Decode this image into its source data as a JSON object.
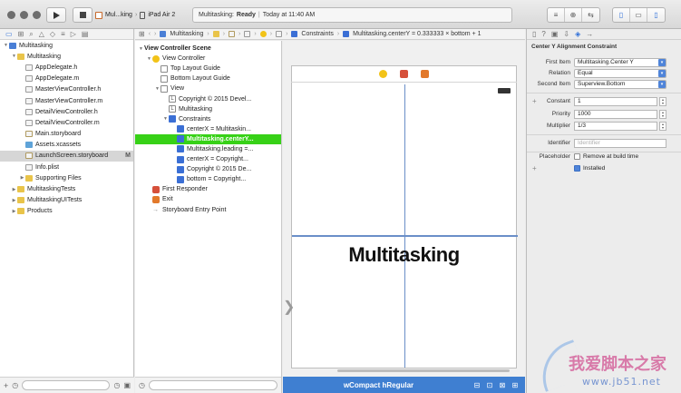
{
  "toolbar": {
    "scheme_name": "Mul...king",
    "device_name": "iPad Air 2",
    "status_app": "Multitasking:",
    "status_state": "Ready",
    "status_sep": "|",
    "status_time": "Today at 11:40 AM"
  },
  "navigator": {
    "items": [
      {
        "label": "Multitasking",
        "type": "proj",
        "indent": 0,
        "disclosure": "▼"
      },
      {
        "label": "Multitasking",
        "type": "folder",
        "indent": 1,
        "disclosure": "▼"
      },
      {
        "label": "AppDelegate.h",
        "type": "hfile",
        "indent": 2,
        "disclosure": ""
      },
      {
        "label": "AppDelegate.m",
        "type": "mfile",
        "indent": 2,
        "disclosure": ""
      },
      {
        "label": "MasterViewController.h",
        "type": "hfile",
        "indent": 2,
        "disclosure": ""
      },
      {
        "label": "MasterViewController.m",
        "type": "mfile",
        "indent": 2,
        "disclosure": ""
      },
      {
        "label": "DetailViewController.h",
        "type": "hfile",
        "indent": 2,
        "disclosure": ""
      },
      {
        "label": "DetailViewController.m",
        "type": "mfile",
        "indent": 2,
        "disclosure": ""
      },
      {
        "label": "Main.storyboard",
        "type": "sbfile",
        "indent": 2,
        "disclosure": ""
      },
      {
        "label": "Assets.xcassets",
        "type": "xc",
        "indent": 2,
        "disclosure": ""
      },
      {
        "label": "LaunchScreen.storyboard",
        "type": "sbfile",
        "indent": 2,
        "disclosure": "",
        "selected": true,
        "badge": "M"
      },
      {
        "label": "Info.plist",
        "type": "plist",
        "indent": 2,
        "disclosure": ""
      },
      {
        "label": "Supporting Files",
        "type": "folder",
        "indent": 2,
        "disclosure": "▶"
      },
      {
        "label": "MultitaskingTests",
        "type": "folder",
        "indent": 1,
        "disclosure": "▶"
      },
      {
        "label": "MultitaskingUITests",
        "type": "folder",
        "indent": 1,
        "disclosure": "▶"
      },
      {
        "label": "Products",
        "type": "folder",
        "indent": 1,
        "disclosure": "▶"
      }
    ]
  },
  "jumpbar": {
    "crumb_project": "Multitasking",
    "crumb_constraints": "Constraints",
    "crumb_current": "Multitasking.centerY = 0.333333 × bottom + 1"
  },
  "outline": {
    "items": [
      {
        "label": "View Controller Scene",
        "icon": "none",
        "indent": 0,
        "disclosure": "▼",
        "bold": true
      },
      {
        "label": "View Controller",
        "icon": "vc",
        "indent": 1,
        "disclosure": "▼"
      },
      {
        "label": "Top Layout Guide",
        "icon": "view",
        "indent": 2,
        "disclosure": ""
      },
      {
        "label": "Bottom Layout Guide",
        "icon": "view",
        "indent": 2,
        "disclosure": ""
      },
      {
        "label": "View",
        "icon": "view",
        "indent": 2,
        "disclosure": "▼"
      },
      {
        "label": "Copyright © 2015 Devel...",
        "icon": "lbl",
        "indent": 3,
        "disclosure": ""
      },
      {
        "label": "Multitasking",
        "icon": "lbl",
        "indent": 3,
        "disclosure": ""
      },
      {
        "label": "Constraints",
        "icon": "con",
        "indent": 3,
        "disclosure": "▼"
      },
      {
        "label": "centerX = Multitaskin...",
        "icon": "con",
        "indent": 4,
        "disclosure": ""
      },
      {
        "label": "Multitasking.centerY...",
        "icon": "con",
        "indent": 4,
        "disclosure": "",
        "highlight": true
      },
      {
        "label": "Multitasking.leading =...",
        "icon": "con",
        "indent": 4,
        "disclosure": ""
      },
      {
        "label": "centerX = Copyright...",
        "icon": "con",
        "indent": 4,
        "disclosure": ""
      },
      {
        "label": "Copyright © 2015 De...",
        "icon": "con",
        "indent": 4,
        "disclosure": ""
      },
      {
        "label": "bottom = Copyright...",
        "icon": "con",
        "indent": 4,
        "disclosure": ""
      },
      {
        "label": "First Responder",
        "icon": "fr",
        "indent": 1,
        "disclosure": ""
      },
      {
        "label": "Exit",
        "icon": "exit",
        "indent": 1,
        "disclosure": ""
      },
      {
        "label": "Storyboard Entry Point",
        "icon": "arrow",
        "indent": 1,
        "disclosure": ""
      }
    ]
  },
  "canvas": {
    "scene_title": "Multitasking",
    "size_class": "wCompact hRegular"
  },
  "inspector": {
    "header": "Center Y Alignment Constraint",
    "first_item_label": "First Item",
    "first_item_value": "Multitasking.Center Y",
    "relation_label": "Relation",
    "relation_value": "Equal",
    "second_item_label": "Second Item",
    "second_item_value": "Superview.Bottom",
    "constant_label": "Constant",
    "constant_value": "1",
    "priority_label": "Priority",
    "priority_value": "1000",
    "multiplier_label": "Multiplier",
    "multiplier_value": "1/3",
    "identifier_label": "Identifier",
    "identifier_placeholder": "Identifier",
    "placeholder_label": "Placeholder",
    "remove_label": "Remove at build time",
    "installed_label": "Installed"
  },
  "watermark": {
    "text": "我爱脚本之家",
    "url": "www.jb51.net"
  },
  "colors": {
    "selection_green": "#37d117",
    "accent_blue": "#3f7fd1",
    "guide_blue": "#6a8fc8"
  }
}
